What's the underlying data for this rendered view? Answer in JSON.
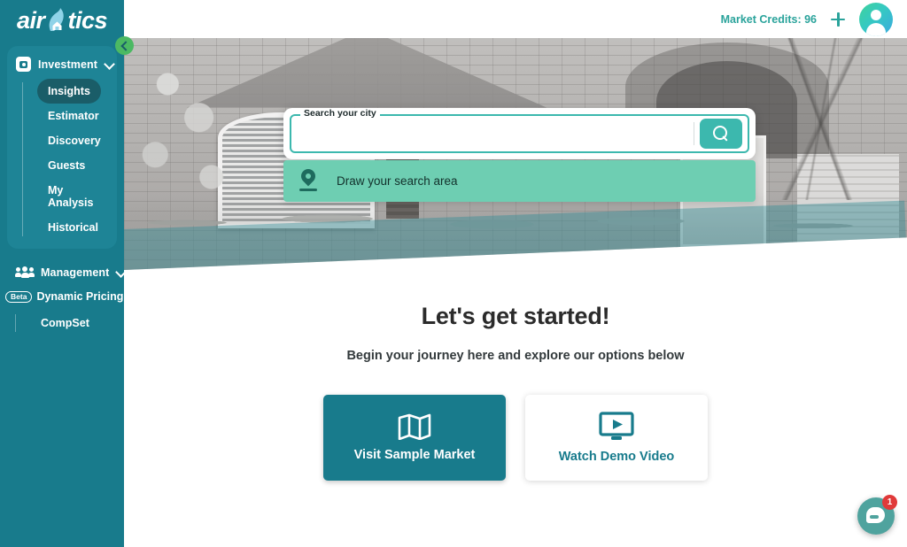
{
  "brand": {
    "name_part1": "air",
    "name_part2": "tics",
    "logo_icon": "house-logo-icon",
    "primary": "#187B8C",
    "accent": "#3CB8AE",
    "accent_light": "#6ECEB2",
    "active_pill": "#1A5D68"
  },
  "sidebar": {
    "collapse_icon": "chevron-left-icon",
    "groups": [
      {
        "label": "Investment",
        "icon": "investment-icon",
        "chevron": "chevron-down-icon",
        "items": [
          {
            "label": "Insights",
            "active": true
          },
          {
            "label": "Estimator",
            "active": false
          },
          {
            "label": "Discovery",
            "active": false
          },
          {
            "label": "Guests",
            "active": false
          },
          {
            "label": "My Analysis",
            "active": false
          },
          {
            "label": "Historical",
            "active": false
          }
        ]
      },
      {
        "label": "Management",
        "icon": "people-group-icon",
        "chevron": "chevron-down-icon",
        "badge_item": {
          "badge": "Beta",
          "label": "Dynamic Pricing"
        },
        "items": [
          {
            "label": "CompSet",
            "active": false
          }
        ]
      }
    ]
  },
  "header": {
    "credits_label": "Market Credits: 96",
    "add_icon": "plus-icon",
    "avatar_icon": "user-avatar-icon"
  },
  "search": {
    "legend": "Search your city",
    "value": "",
    "placeholder": "",
    "search_icon": "search-icon",
    "suggestion": {
      "icon": "location-pin-icon",
      "label": "Draw your search area"
    }
  },
  "main": {
    "heading": "Let's get started!",
    "subheading": "Begin your journey here and explore our options below",
    "cards": [
      {
        "label": "Visit Sample Market",
        "icon": "map-icon",
        "style": "filled"
      },
      {
        "label": "Watch Demo Video",
        "icon": "video-icon",
        "style": "outline"
      }
    ]
  },
  "chat": {
    "icon": "chat-bubble-icon",
    "badge": "1"
  }
}
